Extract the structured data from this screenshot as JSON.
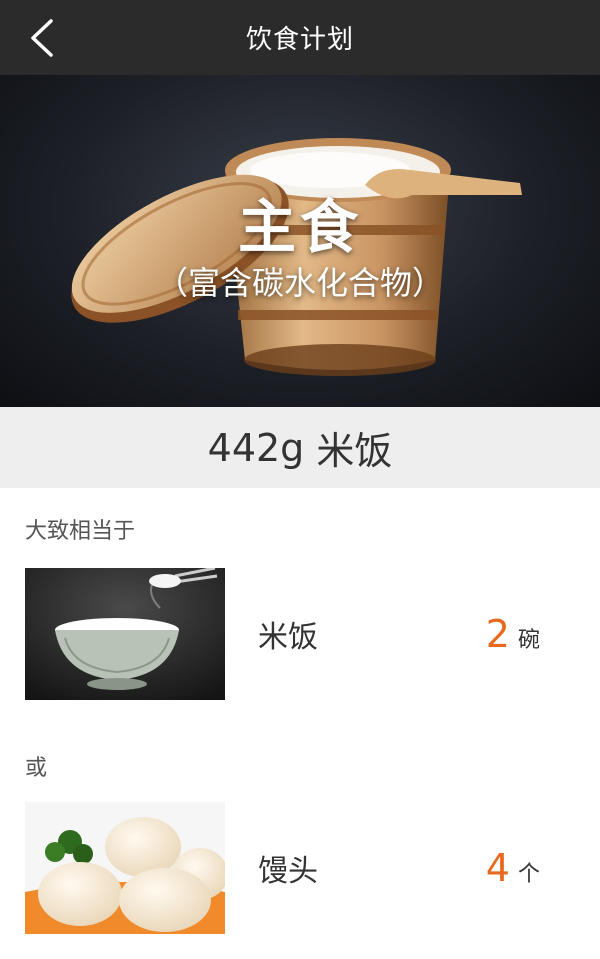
{
  "header": {
    "title": "饮食计划",
    "back_icon": "chevron-left-icon"
  },
  "hero": {
    "title": "主食",
    "subtitle": "（富含碳水化合物）",
    "image": "wooden-rice-tub-photo"
  },
  "amount": {
    "value": "442g",
    "food": "米饭"
  },
  "equivalent_label": "大致相当于",
  "or_label": "或",
  "items": [
    {
      "name": "米饭",
      "count": "2",
      "unit": "碗",
      "image": "rice-bowl-photo"
    },
    {
      "name": "馒头",
      "count": "4",
      "unit": "个",
      "image": "steamed-buns-photo"
    }
  ],
  "colors": {
    "header_bg": "#2b2b2b",
    "accent": "#e8691e",
    "amount_bar_bg": "#eeeeee"
  }
}
